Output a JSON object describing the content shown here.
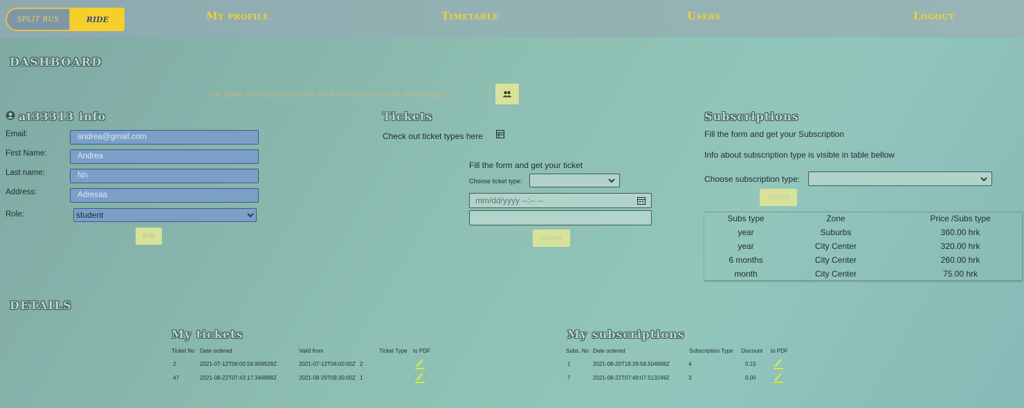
{
  "navbar": {
    "logo_left": "SPLIT BUS",
    "logo_right": "RIDE",
    "links": [
      "My profile",
      "Timetable",
      "Users",
      "Logout"
    ]
  },
  "dashboard": {
    "title": "DASHBOARD",
    "admin_note": "You have admin permissions, click the button to visit admin page"
  },
  "user_info": {
    "title": "at33313 info",
    "email_label": "Email:",
    "email_value": "andrea@gmail.com",
    "first_name_label": "First Name:",
    "first_name_value": "Andrea",
    "last_name_label": "Last name:",
    "last_name_value": "Nn",
    "address_label": "Address:",
    "address_value": "Adresaa",
    "role_label": "Role:",
    "role_value": "student",
    "edit_label": "Edit"
  },
  "tickets": {
    "title": "Tickets",
    "check_text": "Check out ticket types here",
    "form_text": "Fill the form and get your ticket",
    "choose_label": "Choose ticket type:",
    "date_placeholder": "mm/dd/yyyy --:-- --",
    "submit_label": "Submit"
  },
  "subscriptions": {
    "title": "Subscriptions",
    "intro": "Fill the form and get your Subscription",
    "info": "Info about subscription type is visible in table bellow",
    "choose_label": "Choose subscription type:",
    "submit_label": "Submit",
    "table_headers": [
      "Subs type",
      "Zone",
      "Price /Subs type"
    ],
    "table_rows": [
      [
        "year",
        "Suburbs",
        "360.00 hrk"
      ],
      [
        "year",
        "City Center",
        "320.00 hrk"
      ],
      [
        "6 months",
        "City Center",
        "260.00 hrk"
      ],
      [
        "month",
        "City Center",
        "75.00 hrk"
      ]
    ]
  },
  "details": {
    "title": "DETAILS",
    "my_tickets": {
      "title": "My tickets",
      "headers": [
        "Ticket No",
        "Date ordered",
        "Valid from",
        "Ticket Type",
        "to PDF"
      ],
      "rows": [
        [
          "2",
          "2021-07-12T06:00:59.969929Z",
          "2021-07-12T06:00:00Z",
          "2"
        ],
        [
          "47",
          "2021-08-22T07:43:17.346998Z",
          "2021-08-29T09:30:00Z",
          "1"
        ]
      ]
    },
    "my_subscriptions": {
      "title": "My subscriptions",
      "headers": [
        "Subs. No",
        "Date ordered",
        "Subscription Type",
        "Discount",
        "to PDF"
      ],
      "rows": [
        [
          "1",
          "2021-08-20T18:39:58.504968Z",
          "4",
          "0.15"
        ],
        [
          "7",
          "2021-08-22T07:49:07.513249Z",
          "3",
          "0.00"
        ]
      ]
    }
  },
  "colors": {
    "accent_yellow": "#f6cf36",
    "input_blue": "#7c9fc8",
    "button_green": "#d7e29a",
    "pdf_icon": "#d3e74a"
  },
  "icons": [
    "users-icon",
    "table-icon",
    "calendar-icon",
    "pdf-pen-icon",
    "user-circle-icon",
    "chevron-down-icon"
  ]
}
